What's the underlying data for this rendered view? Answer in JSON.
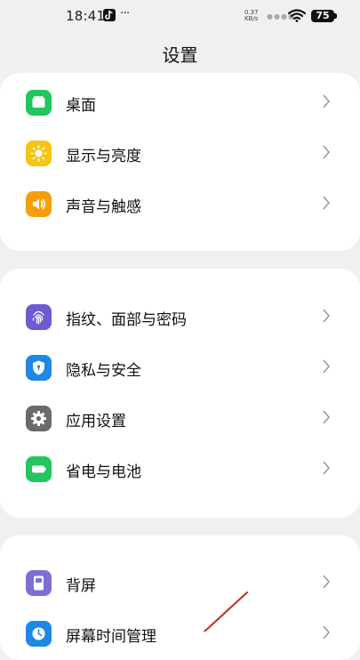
{
  "status_bar": {
    "time": "18:41",
    "more": "···",
    "net_speed_value": "0.37",
    "net_speed_unit": "KB/s",
    "battery": "75"
  },
  "header": {
    "title": "设置"
  },
  "groups": [
    {
      "items": [
        {
          "label": "桌面",
          "icon": "desktop-icon",
          "color": "#22c55e"
        },
        {
          "label": "显示与亮度",
          "icon": "brightness-icon",
          "color": "#f5c518"
        },
        {
          "label": "声音与触感",
          "icon": "sound-icon",
          "color": "#f59e0b"
        }
      ]
    },
    {
      "items": [
        {
          "label": "指纹、面部与密码",
          "icon": "fingerprint-icon",
          "color": "#6d5bd0"
        },
        {
          "label": "隐私与安全",
          "icon": "shield-icon",
          "color": "#1e88e5"
        },
        {
          "label": "应用设置",
          "icon": "gear-icon",
          "color": "#6b6b6b"
        },
        {
          "label": "省电与电池",
          "icon": "battery-icon",
          "color": "#22c55e"
        }
      ]
    },
    {
      "items": [
        {
          "label": "背屏",
          "icon": "back-screen-icon",
          "color": "#7b6fd6"
        },
        {
          "label": "屏幕时间管理",
          "icon": "screen-time-icon",
          "color": "#1e88e5"
        }
      ]
    }
  ],
  "annotation": {
    "color": "#c0392b"
  }
}
